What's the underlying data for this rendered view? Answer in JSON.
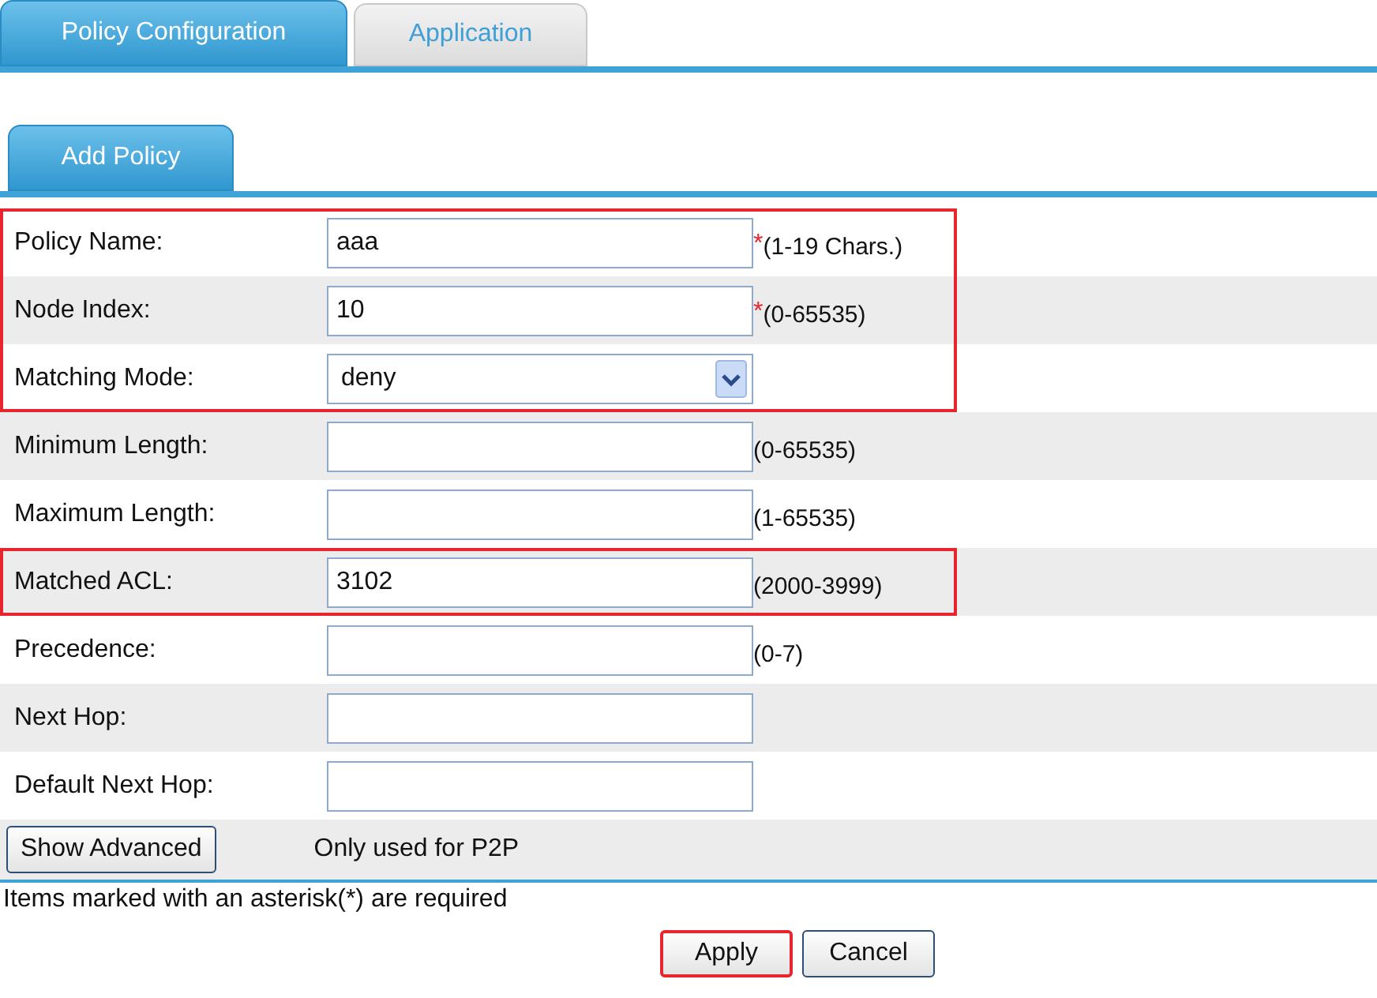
{
  "tabs": [
    {
      "label": "Policy Configuration",
      "selected": true
    },
    {
      "label": "Application",
      "selected": false
    }
  ],
  "subtabs": [
    {
      "label": "Add Policy",
      "selected": true
    }
  ],
  "form": {
    "rows": [
      {
        "label": "Policy Name:",
        "kind": "text",
        "value": "aaa",
        "mark": "*",
        "hint": "(1-19 Chars.)",
        "highlighted": true
      },
      {
        "label": "Node Index:",
        "kind": "text",
        "value": "10",
        "mark": "*",
        "hint": "(0-65535)",
        "highlighted": true
      },
      {
        "label": "Matching Mode:",
        "kind": "select",
        "value": "deny",
        "highlighted": true
      },
      {
        "label": "Minimum Length:",
        "kind": "text",
        "hint": "(0-65535)",
        "highlighted": false
      },
      {
        "label": "Maximum Length:",
        "kind": "text",
        "hint": "(1-65535)",
        "highlighted": false
      },
      {
        "label": "Matched ACL:",
        "kind": "text",
        "value": "3102",
        "hint": "(2000-3999)",
        "highlighted": true
      },
      {
        "label": "Precedence:",
        "kind": "text",
        "hint": "(0-7)",
        "highlighted": false
      },
      {
        "label": "Next Hop:",
        "kind": "text",
        "highlighted": false
      },
      {
        "label": "Default Next Hop:",
        "kind": "text",
        "highlighted": false
      }
    ],
    "advanced": {
      "button": "Show Advanced",
      "note": "Only used for P2P"
    }
  },
  "footnote": "Items marked with an asterisk(*) are required",
  "buttons": [
    {
      "label": "Apply",
      "highlighted": true
    },
    {
      "label": "Cancel",
      "highlighted": false
    }
  ]
}
